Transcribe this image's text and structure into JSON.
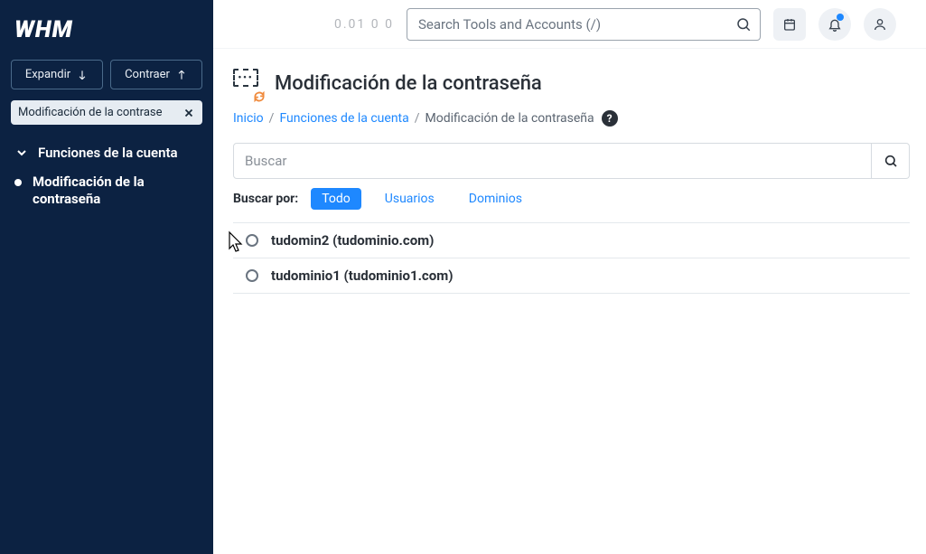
{
  "logo": "WHM",
  "sidebar": {
    "expand_label": "Expandir",
    "collapse_label": "Contraer",
    "filter_text": "Modificación de la contrase",
    "category_label": "Funciones de la cuenta",
    "active_item": "Modificación de la contraseña"
  },
  "topbar": {
    "load": "0.01  0  0",
    "search_placeholder": "Search Tools and Accounts (/)"
  },
  "page": {
    "title": "Modificación de la contraseña",
    "crumbs": {
      "home": "Inicio",
      "cat": "Funciones de la cuenta",
      "current": "Modificación de la contraseña"
    },
    "filter_placeholder": "Buscar",
    "searchby_label": "Buscar por:",
    "filters": {
      "all": "Todo",
      "users": "Usuarios",
      "domains": "Dominios"
    },
    "accounts": [
      {
        "label": "tudomin2 (tudominio.com)"
      },
      {
        "label": "tudominio1 (tudominio1.com)"
      }
    ]
  }
}
